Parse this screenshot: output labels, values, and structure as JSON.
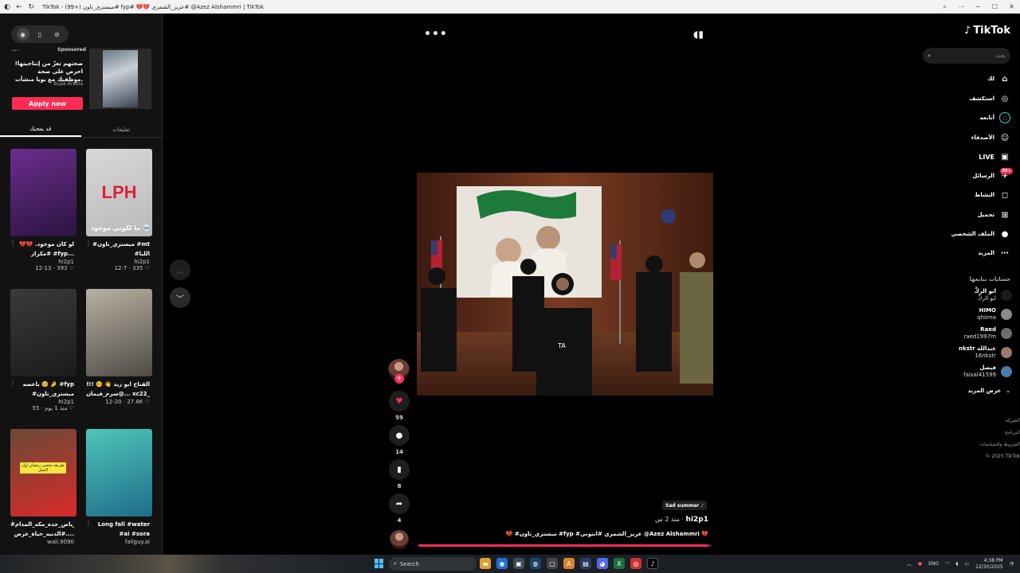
{
  "window": {
    "title": "TikTok - (99+) ميستري_تاون# fyp# 💔💔 عزيز_الشمري# @Azez Alshammri | TikTok",
    "controls": {
      "search": "⌕",
      "menu": "⋯",
      "minimize": "─",
      "maximize": "☐",
      "close": "✕"
    }
  },
  "left": {
    "ad": {
      "sponsored": "Sponsored",
      "text": "صحتهم تعزّ من إنتاجيتها! احرص على صحة موظفيك مع بوبا منشأت.",
      "brand": "Bupa Arabia",
      "apply": "Apply now",
      "more": "..."
    },
    "tabs": [
      {
        "label": "قد يعجبك"
      },
      {
        "label": "تعليقات"
      }
    ],
    "cards": [
      {
        "caption": "لو كان موجود. 💔💔 #مكراز #fyp...",
        "user": "hi2p1",
        "likes": "393",
        "date": "12-13",
        "colorA": "#6b2e8c",
        "colorB": "#2a1440"
      },
      {
        "caption": "#ميستري_تاون #mt #اللبا #عبدالمحسن_القرشي",
        "user": "hi2p1",
        "likes": "335",
        "date": "12-7",
        "colorA": "#d8d8d8",
        "colorB": "#b9b9b9",
        "overlay": "LPH",
        "sub": "ما لكوني موجود 💀"
      },
      {
        "caption": "باعصه 🥺 🤌 #fyp #ميستري_تاون #رعي...",
        "user": "hi2p1",
        "likes": "55",
        "date": "منذ 1 يوم",
        "colorA": "#3a3a3a",
        "colorB": "#1b1b1b"
      },
      {
        "caption": "القناح ابو زيد 👋 🤒 !!! @سرم_فيمان... xc22_",
        "user": "",
        "likes": "27.8K",
        "date": "12-20",
        "colorA": "#b9b2a3",
        "colorB": "#4e4a45"
      },
      {
        "caption": "#الرياض_جده_مكه_المدام #الدنيه_حياة_عرض....",
        "user": "wali.9090",
        "likes": "",
        "date": "",
        "colorA": "#6b4a36",
        "colorB": "#d72a2a",
        "tag": "طريقة تحضير رمضان اول العمل"
      },
      {
        "caption": "Long fall #water #ai #sora",
        "user": "fallguy.ai",
        "likes": "",
        "date": "",
        "colorA": "#4fc6b8",
        "colorB": "#1e6d8a"
      }
    ]
  },
  "center": {
    "more_dots": "•••",
    "video_overlay_text": "TA",
    "actions": {
      "like_count": "59",
      "comment_count": "14",
      "save_count": "8",
      "share_count": "4"
    },
    "sound_tag": "Sad summer",
    "author": "hi2p1",
    "posted": "منذ 2 س",
    "description": "💔 #ميستري_تاون #fyp #عزيز_الشمري #انتوني @Azez Alshammri 💔",
    "progress": 0.99
  },
  "right": {
    "logo": "TikTok",
    "search_placeholder": "بحث",
    "nav": [
      {
        "label": "لك",
        "icon": "home-icon",
        "glyph": "⌂"
      },
      {
        "label": "استكشف",
        "icon": "compass-icon",
        "glyph": "◎"
      },
      {
        "label": "أتابعه",
        "icon": "following-icon",
        "glyph": "◌"
      },
      {
        "label": "الأصدقاء",
        "icon": "friends-icon",
        "glyph": "☺"
      },
      {
        "label": "LIVE",
        "icon": "live-icon",
        "glyph": "▣"
      },
      {
        "label": "الرسائل",
        "icon": "messages-icon",
        "glyph": "✈"
      },
      {
        "label": "النشاط",
        "icon": "activity-icon",
        "glyph": "◻"
      },
      {
        "label": "تحميل",
        "icon": "upload-icon",
        "glyph": "⊞"
      },
      {
        "label": "الملف الشخصي",
        "icon": "profile-icon",
        "glyph": "●"
      },
      {
        "label": "المزيد",
        "icon": "more-icon",
        "glyph": "⋯"
      }
    ],
    "messages_badge": "99+",
    "following_title": "حسابات تتابعها",
    "accounts": [
      {
        "name": "ابو الركَّ",
        "handle": "ابو الركَّ"
      },
      {
        "name": "HIMO",
        "handle": "qhiimo"
      },
      {
        "name": "Raed",
        "handle": "raed1997m"
      },
      {
        "name": "nkstr عبدالله",
        "handle": "16nkstr"
      },
      {
        "name": "فيصل",
        "handle": "faisal41599"
      }
    ],
    "see_more": "عرض المزيد",
    "footer": [
      "الشركة",
      "البرنامج",
      "الشروط والسياسات",
      "© 2025 TikTok"
    ]
  },
  "taskbar": {
    "search": "Search",
    "lang": "ENG",
    "time": "4:38 PM",
    "date": "12/30/2025"
  },
  "colors": {
    "accent": "#fe2c55",
    "bg": "#000000",
    "panel": "#121212"
  }
}
